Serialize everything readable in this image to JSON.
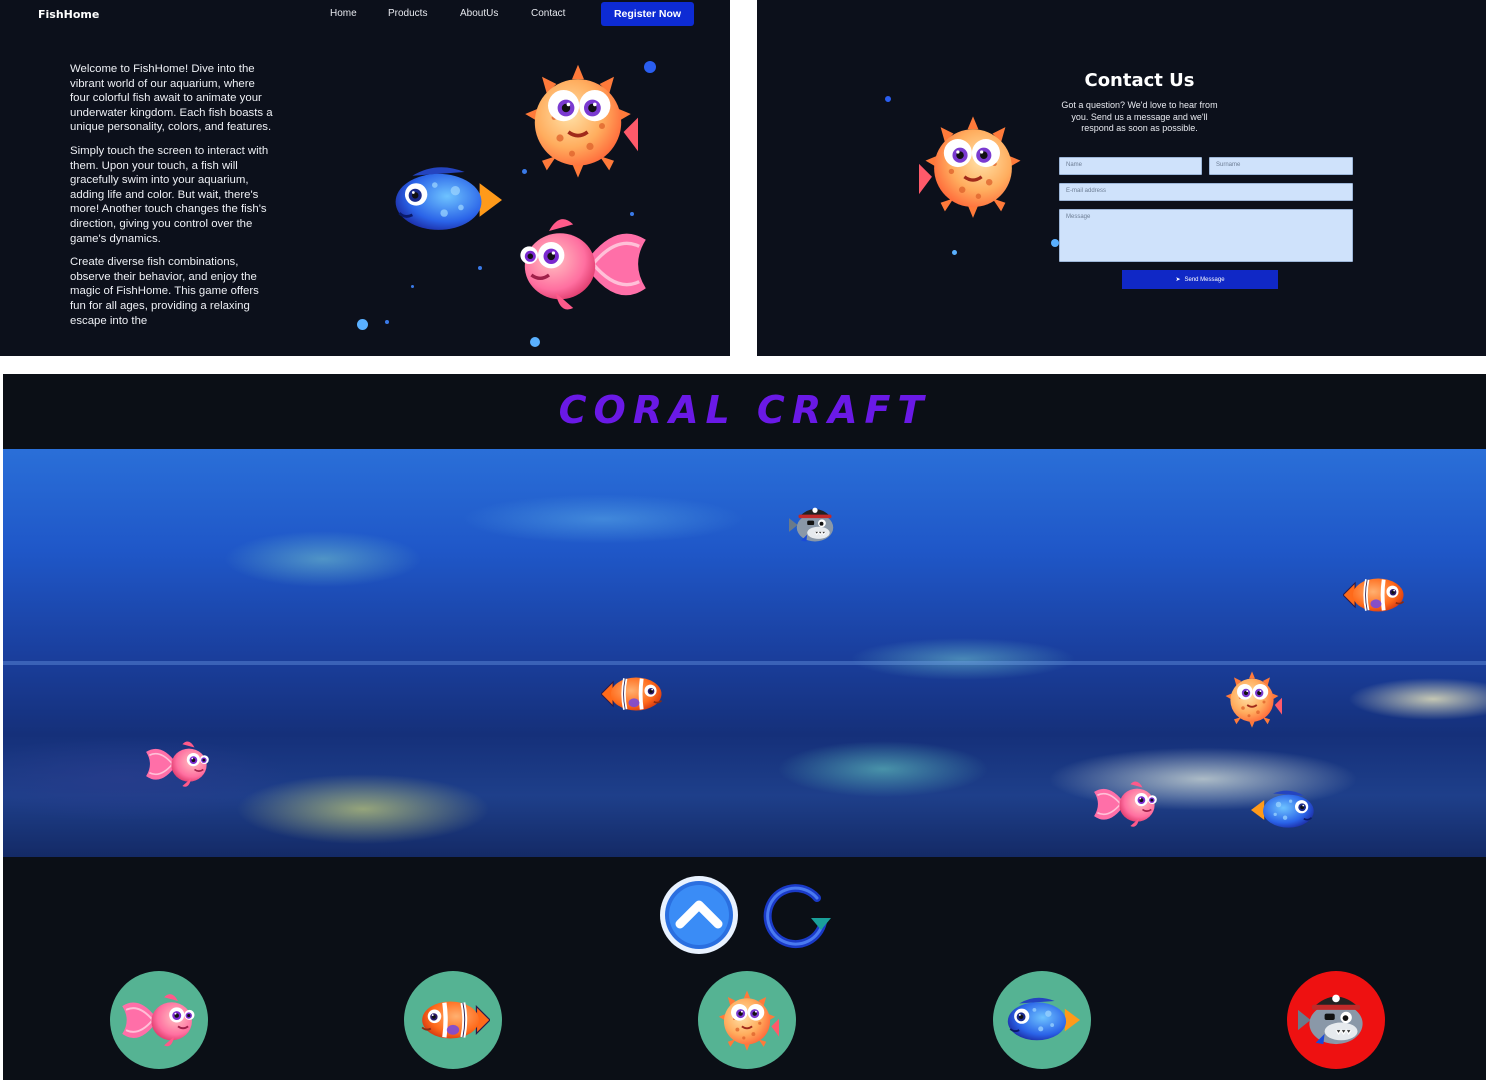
{
  "landing": {
    "brand": "FishHome",
    "nav": [
      "Home",
      "Products",
      "AboutUs",
      "Contact"
    ],
    "register_label": "Register Now",
    "paragraphs": [
      "Welcome to FishHome! Dive into the vibrant world of our aquarium, where four colorful fish await to animate your underwater kingdom. Each fish boasts a unique personality, colors, and features.",
      "Simply touch the screen to interact with them. Upon your touch, a fish will gracefully swim into your aquarium, adding life and color. But wait, there's more! Another touch changes the fish's direction, giving you control over the game's dynamics.",
      "Create diverse fish combinations, observe their behavior, and enjoy the magic of FishHome. This game offers fun for all ages, providing a relaxing escape into the"
    ]
  },
  "contact": {
    "title": "Contact Us",
    "subtitle": "Got a question? We'd love to hear from you. Send us a message and we'll respond as soon as possible.",
    "name_placeholder": "Name",
    "surname_placeholder": "Surname",
    "email_placeholder": "E-mail address",
    "message_placeholder": "Message",
    "send_label": "Send Message"
  },
  "game": {
    "title": "CORAL CRAFT",
    "fish_picker": [
      "goldfish-icon",
      "clownfish-icon",
      "pufferfish-icon",
      "blue-tang-icon",
      "pirate-shark-icon"
    ],
    "selected_fish": "pirate-shark-icon"
  },
  "colors": {
    "bg": "#0c101b",
    "accent": "#0d2bd4",
    "title": "#6a19e6",
    "picker": "#55b393",
    "picker_selected": "#ee1111"
  }
}
